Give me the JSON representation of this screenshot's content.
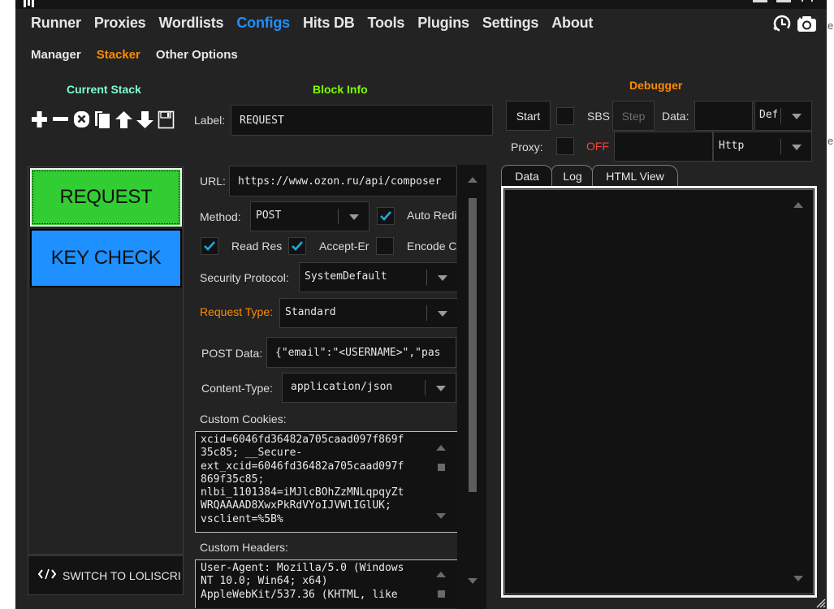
{
  "window": {
    "title_icon": "openbullet-logo-icon",
    "controls": [
      "minimize-button",
      "maximize-button",
      "close-button"
    ]
  },
  "background_fragments": [
    "e.",
    "e."
  ],
  "nav": {
    "items": [
      {
        "label": "Runner",
        "active": false
      },
      {
        "label": "Proxies",
        "active": false
      },
      {
        "label": "Wordlists",
        "active": false
      },
      {
        "label": "Configs",
        "active": true
      },
      {
        "label": "Hits DB",
        "active": false
      },
      {
        "label": "Tools",
        "active": false
      },
      {
        "label": "Plugins",
        "active": false
      },
      {
        "label": "Settings",
        "active": false
      },
      {
        "label": "About",
        "active": false
      }
    ],
    "icons": [
      "history-icon",
      "camera-icon"
    ]
  },
  "subnav": {
    "items": [
      {
        "label": "Manager",
        "active": false
      },
      {
        "label": "Stacker",
        "active": true
      },
      {
        "label": "Other Options",
        "active": false
      }
    ]
  },
  "colors": {
    "accent_blue": "#1e90ff",
    "accent_orange": "#ff8c00",
    "current_stack_title": "#7fffd4",
    "block_info_title": "#7fff00",
    "debugger_title": "#ff8c00",
    "off_red": "#ff4136",
    "block_request": "#32cd32",
    "block_keycheck": "#1e90ff",
    "checkmark": "#1ea7e1"
  },
  "current_stack": {
    "title": "Current Stack",
    "tools": [
      "add-block-icon",
      "remove-block-icon",
      "delete-all-icon",
      "clone-icon",
      "move-up-icon",
      "move-down-icon",
      "save-icon"
    ],
    "blocks": [
      {
        "label": "REQUEST",
        "selected": true
      },
      {
        "label": "KEY CHECK",
        "selected": false
      }
    ],
    "switch_button": "SWITCH TO LOLISCRI"
  },
  "block_info": {
    "title": "Block Info",
    "label_caption": "Label:",
    "label_value": "REQUEST",
    "url_caption": "URL:",
    "url_value": "https://www.ozon.ru/api/composer",
    "method_caption": "Method:",
    "method_value": "POST",
    "auto_redirect": {
      "label": "Auto Redi",
      "checked": true
    },
    "read_response": {
      "label": "Read Resp",
      "checked": true
    },
    "accept_encoding": {
      "label": "Accept-Er",
      "checked": true
    },
    "encode_content": {
      "label": "Encode C",
      "checked": false
    },
    "security_protocol_caption": "Security Protocol:",
    "security_protocol_value": "SystemDefault",
    "request_type_caption": "Request Type:",
    "request_type_value": "Standard",
    "post_data_caption": "POST Data:",
    "post_data_value": "{\"email\":\"<USERNAME>\",\"pas",
    "content_type_caption": "Content-Type:",
    "content_type_value": "application/json",
    "custom_cookies_caption": "Custom Cookies:",
    "custom_cookies_lines": [
      "xcid=6046fd36482a705caad097f869f",
      "35c85; __Secure-",
      "ext_xcid=6046fd36482a705caad097f",
      "869f35c85;",
      "nlbi_1101384=iMJlcBOhZzMNLqpqyZt",
      "WRQAAAAD8XwxPkRdVYoIJVWlIGlUK;",
      "vsclient=%5B%"
    ],
    "custom_headers_caption": "Custom Headers:",
    "custom_headers_lines": [
      "User-Agent: Mozilla/5.0 (Windows",
      "NT 10.0; Win64; x64)",
      "AppleWebKit/537.36 (KHTML, like"
    ]
  },
  "debugger": {
    "title": "Debugger",
    "start_label": "Start",
    "sbs_label": "SBS",
    "sbs_checked": false,
    "step_label": "Step",
    "data_caption": "Data:",
    "data_value": "",
    "data_type_value": "Def",
    "proxy_caption": "Proxy:",
    "proxy_checked": false,
    "proxy_state": "OFF",
    "proxy_value": "",
    "proxy_type_value": "Http",
    "tabs": [
      {
        "label": "Data",
        "active": true
      },
      {
        "label": "Log",
        "active": false
      },
      {
        "label": "HTML View",
        "active": false
      }
    ]
  }
}
